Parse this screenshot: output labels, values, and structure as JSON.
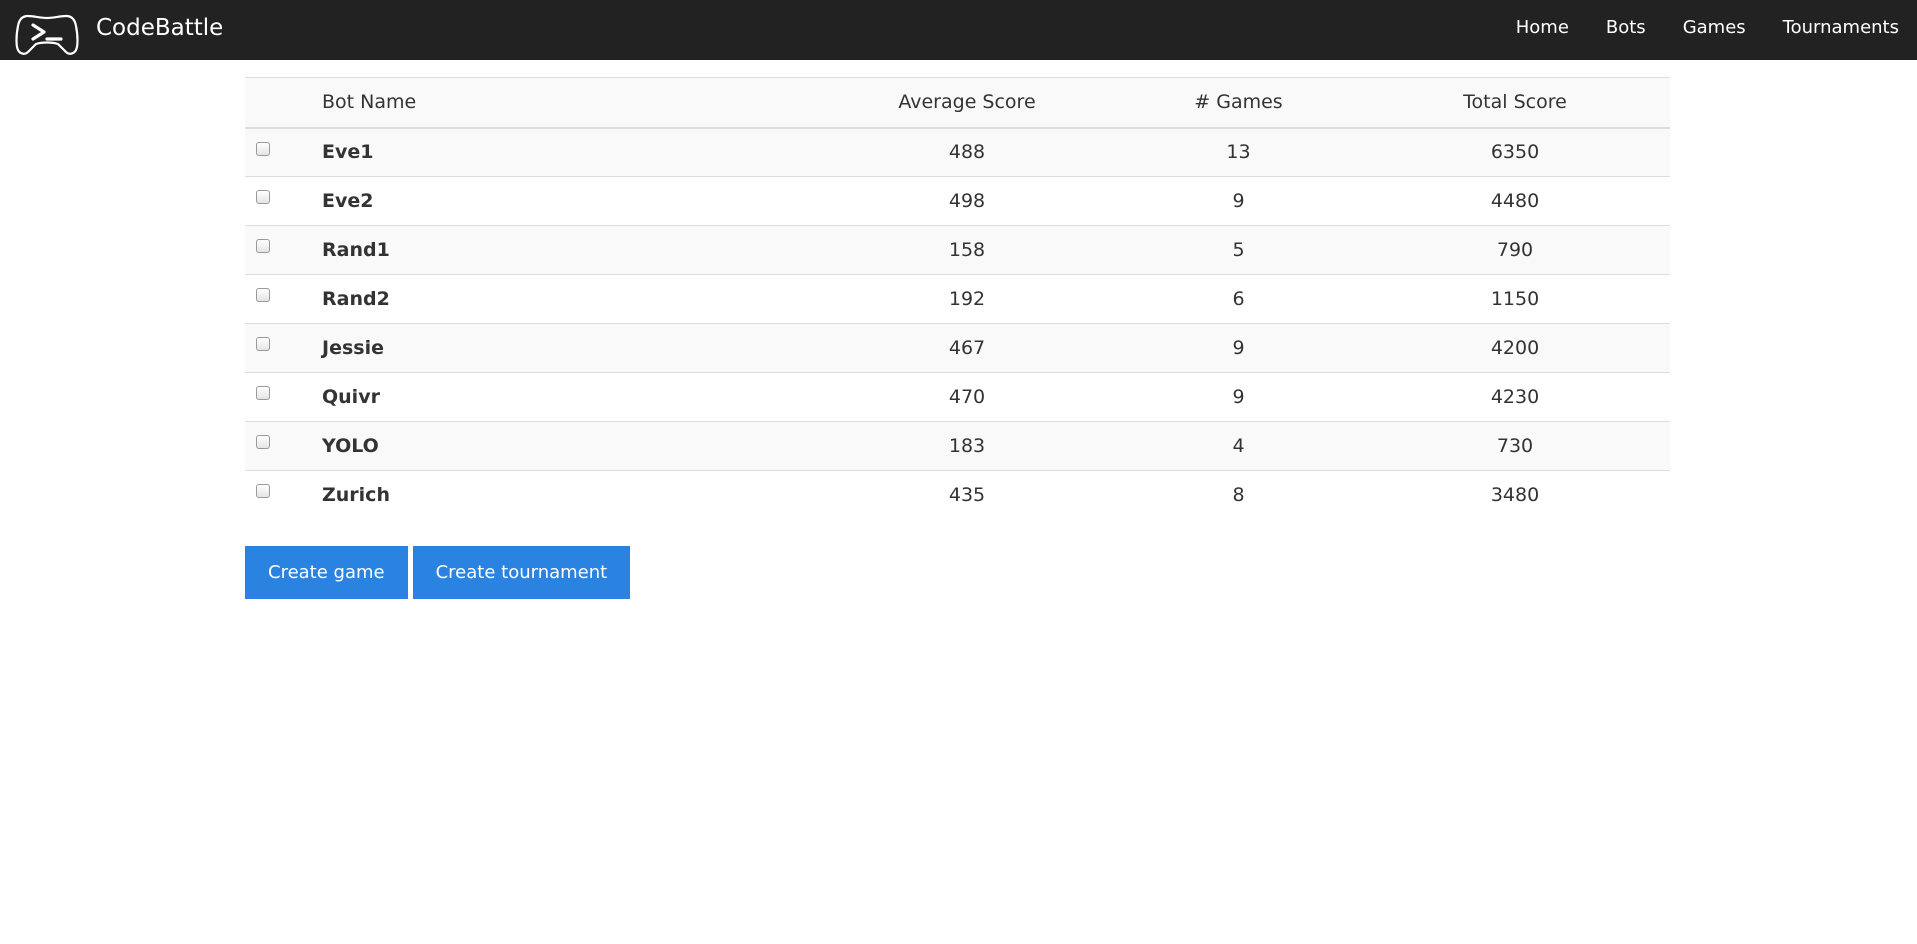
{
  "navbar": {
    "brand_logo_icon": "gamepad-terminal-icon",
    "brand_name": "CodeBattle",
    "links": [
      "Home",
      "Bots",
      "Games",
      "Tournaments"
    ]
  },
  "table": {
    "headers": {
      "bot_name": "Bot Name",
      "average_score": "Average Score",
      "games": "# Games",
      "total_score": "Total Score"
    },
    "rows": [
      {
        "name": "Eve1",
        "average_score": "488",
        "games": "13",
        "total_score": "6350",
        "checked": false
      },
      {
        "name": "Eve2",
        "average_score": "498",
        "games": "9",
        "total_score": "4480",
        "checked": false
      },
      {
        "name": "Rand1",
        "average_score": "158",
        "games": "5",
        "total_score": "790",
        "checked": false
      },
      {
        "name": "Rand2",
        "average_score": "192",
        "games": "6",
        "total_score": "1150",
        "checked": false
      },
      {
        "name": "Jessie",
        "average_score": "467",
        "games": "9",
        "total_score": "4200",
        "checked": false
      },
      {
        "name": "Quivr",
        "average_score": "470",
        "games": "9",
        "total_score": "4230",
        "checked": false
      },
      {
        "name": "YOLO",
        "average_score": "183",
        "games": "4",
        "total_score": "730",
        "checked": false
      },
      {
        "name": "Zurich",
        "average_score": "435",
        "games": "8",
        "total_score": "3480",
        "checked": false
      }
    ]
  },
  "actions": {
    "create_game_label": "Create game",
    "create_tournament_label": "Create tournament"
  },
  "colors": {
    "navbar_bg": "#222222",
    "primary_button": "#2a83e1",
    "striped_row": "#f9f9f9",
    "border": "#dddddd"
  }
}
